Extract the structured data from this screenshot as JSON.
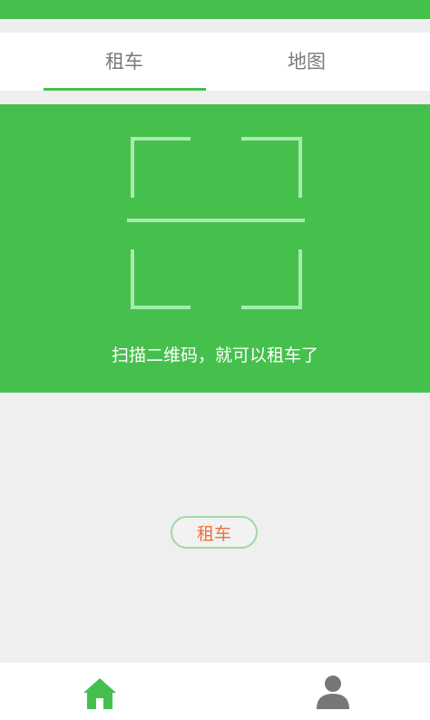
{
  "tabs": {
    "rent_label": "租车",
    "map_label": "地图",
    "active": "rent"
  },
  "scan": {
    "hint": "扫描二维码，就可以租车了"
  },
  "actions": {
    "rent_button_label": "租车"
  },
  "bottom_nav": {
    "home_icon": "home-icon",
    "profile_icon": "user-icon"
  },
  "colors": {
    "brand_green": "#46c04c",
    "scan_frame": "#a5ecb0",
    "rent_button_text": "#ed7036",
    "inactive_icon": "#777777"
  }
}
